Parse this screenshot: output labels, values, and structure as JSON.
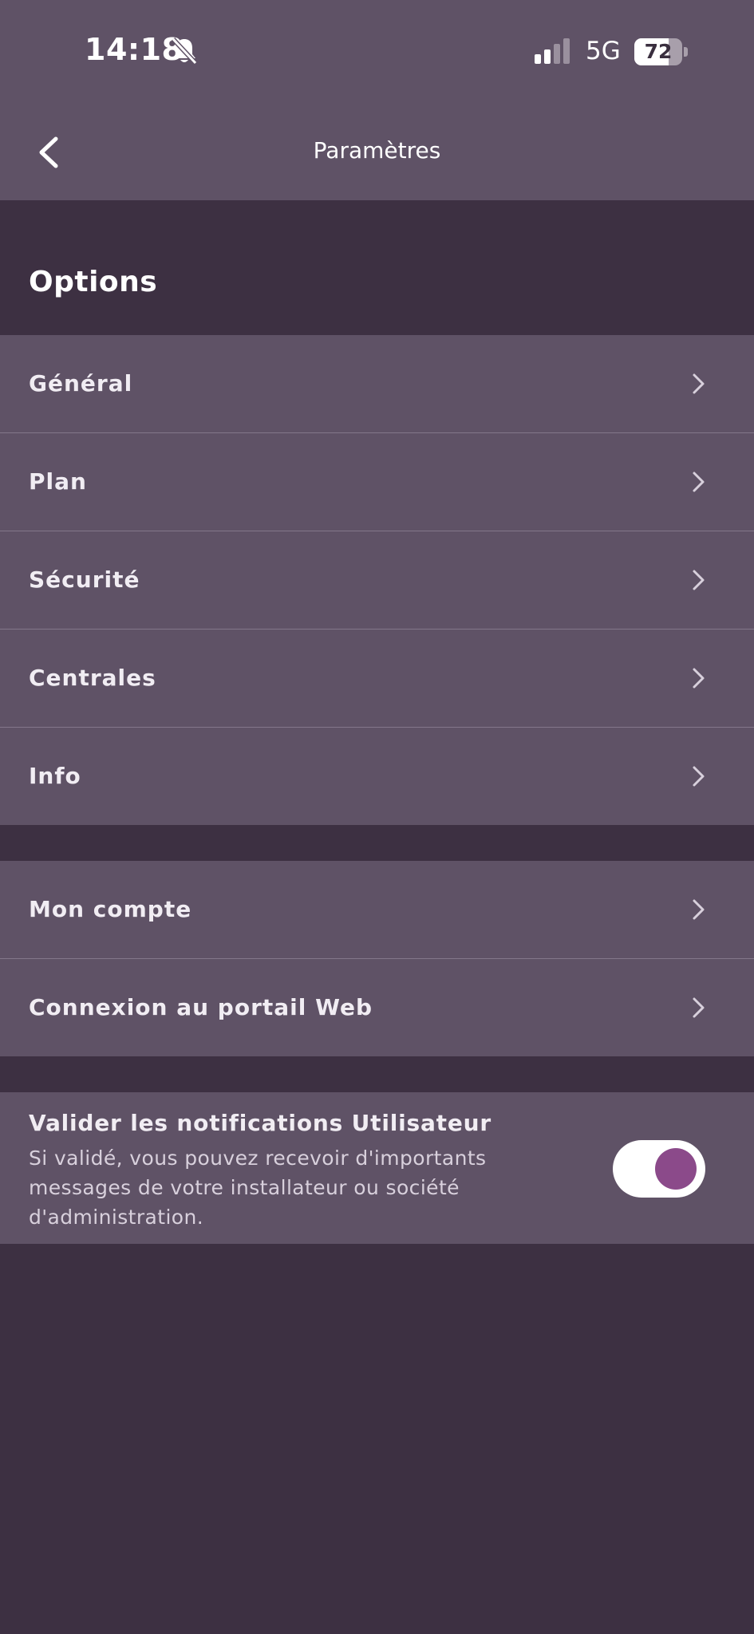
{
  "status_bar": {
    "time": "14:18",
    "mute_icon": "bell-slash-icon",
    "signal_icon": "cellular-signal-icon",
    "network": "5G",
    "battery_level": "72",
    "battery_fraction": 0.72
  },
  "navbar": {
    "back_icon": "chevron-left-icon",
    "title": "Paramètres"
  },
  "options": {
    "header": "Options",
    "items": [
      {
        "label": "Général",
        "icon": "chevron-right-icon"
      },
      {
        "label": "Plan",
        "icon": "chevron-right-icon"
      },
      {
        "label": "Sécurité",
        "icon": "chevron-right-icon"
      },
      {
        "label": "Centrales",
        "icon": "chevron-right-icon"
      },
      {
        "label": "Info",
        "icon": "chevron-right-icon"
      }
    ]
  },
  "account": {
    "items": [
      {
        "label": "Mon compte",
        "icon": "chevron-right-icon"
      },
      {
        "label": "Connexion au portail Web",
        "icon": "chevron-right-icon"
      }
    ]
  },
  "notifications": {
    "title": "Valider les notifications Utilisateur",
    "description": "Si validé, vous pouvez recevoir d'importants messages de votre installateur ou société d'administration.",
    "toggle_on": true
  },
  "colors": {
    "background": "#3d3042",
    "surface": "#5f5266",
    "divider": "#83778a",
    "toggle_knob": "#8b4a8a",
    "text_primary": "#ffffff"
  }
}
